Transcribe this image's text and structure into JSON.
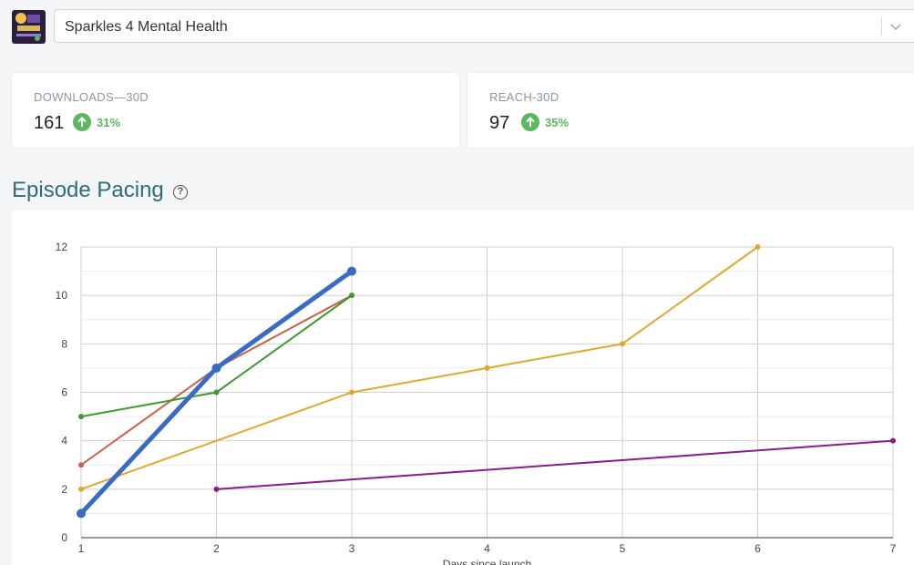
{
  "header": {
    "podcast_selected": "Sparkles 4 Mental Health",
    "logo_icon": "podcast-cover-art",
    "chevron_icon": "chevron-down-icon"
  },
  "stats": [
    {
      "label": "DOWNLOADS—30D",
      "value": "161",
      "change": "31%",
      "direction": "up"
    },
    {
      "label": "REACH-30D",
      "value": "97",
      "change": "35%",
      "direction": "up"
    }
  ],
  "section": {
    "title": "Episode Pacing",
    "help_icon": "help-circle-icon",
    "help_glyph": "?"
  },
  "colors": {
    "accent_title": "#2e6c7c",
    "positive": "#5cb85c"
  },
  "chart_data": {
    "type": "line",
    "xlabel": "Days since launch",
    "ylabel": "",
    "xlim": [
      1,
      7
    ],
    "ylim": [
      0,
      12
    ],
    "x_ticks": [
      1,
      2,
      3,
      4,
      5,
      6,
      7
    ],
    "y_ticks": [
      0,
      2,
      4,
      6,
      8,
      10,
      12
    ],
    "grid": true,
    "series": [
      {
        "color": "#e0a82e",
        "points": [
          [
            1,
            2
          ],
          [
            3,
            6
          ],
          [
            4,
            7
          ],
          [
            5,
            8
          ],
          [
            6,
            12
          ]
        ]
      },
      {
        "color": "#8b1a8b",
        "points": [
          [
            2,
            2
          ],
          [
            7,
            4
          ]
        ]
      },
      {
        "color": "#c8634a",
        "points": [
          [
            1,
            3
          ],
          [
            2,
            7
          ],
          [
            3,
            10
          ]
        ]
      },
      {
        "color": "#3c9a2e",
        "points": [
          [
            1,
            5
          ],
          [
            2,
            6
          ],
          [
            3,
            10
          ]
        ]
      },
      {
        "color": "#3a6bc4",
        "highlight": true,
        "points": [
          [
            1,
            1
          ],
          [
            2,
            7
          ],
          [
            3,
            11
          ]
        ]
      }
    ]
  }
}
